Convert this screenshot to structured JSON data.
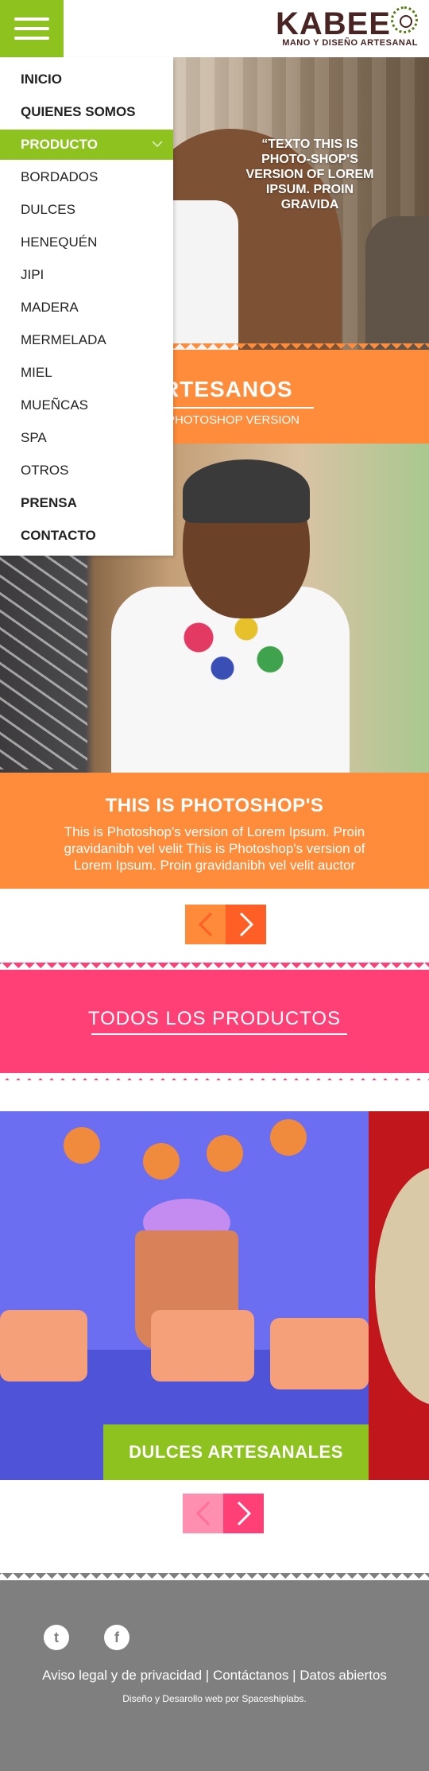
{
  "header": {
    "menu_icon": "hamburger-menu-icon",
    "logo": {
      "brand": "KABEE",
      "tagline": "MANO Y DISEÑO ARTESANAL"
    }
  },
  "nav": {
    "items": [
      {
        "label": "INICIO",
        "bold": true
      },
      {
        "label": "QUIENES SOMOS",
        "bold": true
      },
      {
        "label": "PRODUCTO",
        "bold": true,
        "active": true
      },
      {
        "label": "BORDADOS"
      },
      {
        "label": "DULCES"
      },
      {
        "label": "HENEQUÉN"
      },
      {
        "label": "JIPI"
      },
      {
        "label": "MADERA"
      },
      {
        "label": "MERMELADA"
      },
      {
        "label": "MIEL"
      },
      {
        "label": "MUEÑCAS"
      },
      {
        "label": "SPA"
      },
      {
        "label": "OTROS"
      },
      {
        "label": "PRENSA",
        "bold": true
      },
      {
        "label": "CONTACTO",
        "bold": true
      }
    ]
  },
  "hero": {
    "caption": "“TEXTO THIS IS PHOTO-SHOP'S VERSION OF LOREM IPSUM. PROIN GRAVIDA"
  },
  "artesanos": {
    "title": "RTESANOS",
    "subtitle": "PHOTOSHOP VERSION"
  },
  "photoshop_block": {
    "title": "THIS IS PHOTOSHOP'S",
    "body": "This is Photoshop's version  of Lorem Ipsum. Proin gravidanibh vel velit This is Photoshop's version  of Lorem Ipsum. Proin gravidanibh vel velit auctor"
  },
  "todos": {
    "label": "TODOS LOS PRODUCTOS"
  },
  "product": {
    "label": "DULCES ARTESANALES"
  },
  "footer": {
    "social": [
      {
        "icon": "twitter-icon",
        "glyph": "t"
      },
      {
        "icon": "facebook-icon",
        "glyph": "f"
      }
    ],
    "links": [
      "Aviso legal y de privacidad",
      "Contáctanos",
      "Datos abiertos"
    ],
    "separator": " | ",
    "credit": "Diseño y Desarollo web por Spaceshiplabs."
  },
  "colors": {
    "green": "#8dc21f",
    "orange": "#ff8c3a",
    "pink": "#ff4077",
    "gray": "#7f7f80",
    "arrow_orange_left": "#ff8a3a",
    "arrow_orange_right": "#ff5e24",
    "arrow_pink_left": "#ff8fb0",
    "arrow_pink_right": "#ff4077"
  }
}
